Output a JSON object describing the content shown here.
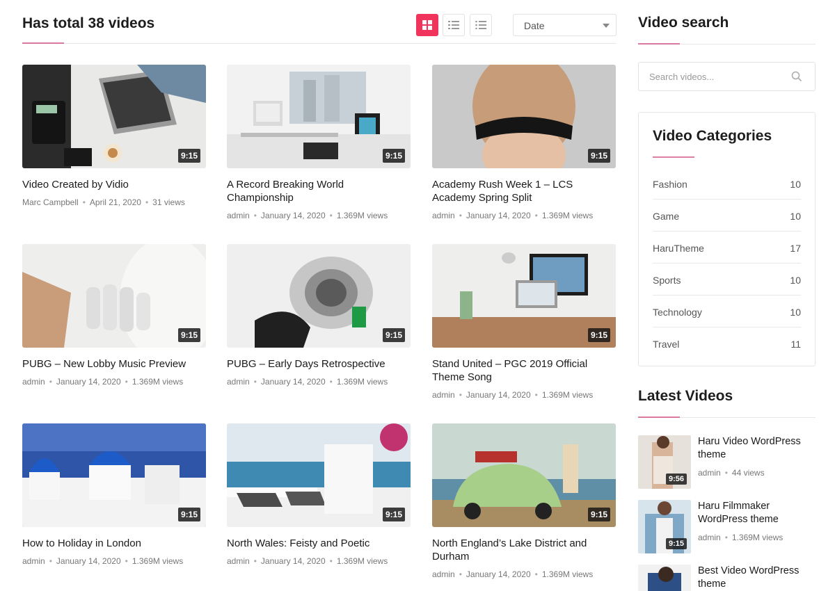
{
  "header": {
    "title": "Has total 38 videos",
    "sort_value": "Date",
    "accent_color": "#f0345b"
  },
  "view_icons": [
    "grid-view-icon",
    "list-view-icon",
    "list-view-alt-icon"
  ],
  "videos": [
    {
      "title": "Video Created by Vidio",
      "author": "Marc Campbell",
      "date": "April 21, 2020",
      "views": "31 views",
      "duration": "9:15"
    },
    {
      "title": "A Record Breaking World Championship",
      "author": "admin",
      "date": "January 14, 2020",
      "views": "1.369M views",
      "duration": "9:15"
    },
    {
      "title": "Academy Rush Week 1 – LCS Academy Spring Split",
      "author": "admin",
      "date": "January 14, 2020",
      "views": "1.369M views",
      "duration": "9:15"
    },
    {
      "title": "PUBG – New Lobby Music Preview",
      "author": "admin",
      "date": "January 14, 2020",
      "views": "1.369M views",
      "duration": "9:15"
    },
    {
      "title": "PUBG – Early Days Retrospective",
      "author": "admin",
      "date": "January 14, 2020",
      "views": "1.369M views",
      "duration": "9:15"
    },
    {
      "title": "Stand United – PGC 2019 Official Theme Song",
      "author": "admin",
      "date": "January 14, 2020",
      "views": "1.369M views",
      "duration": "9:15"
    },
    {
      "title": "How to Holiday in London",
      "author": "admin",
      "date": "January 14, 2020",
      "views": "1.369M views",
      "duration": "9:15"
    },
    {
      "title": "North Wales: Feisty and Poetic",
      "author": "admin",
      "date": "January 14, 2020",
      "views": "1.369M views",
      "duration": "9:15"
    },
    {
      "title": "North England’s Lake District and Durham",
      "author": "admin",
      "date": "January 14, 2020",
      "views": "1.369M views",
      "duration": "9:15"
    }
  ],
  "sidebar": {
    "search_title": "Video search",
    "search_placeholder": "Search videos...",
    "categories_title": "Video Categories",
    "categories": [
      {
        "name": "Fashion",
        "count": "10"
      },
      {
        "name": "Game",
        "count": "10"
      },
      {
        "name": "HaruTheme",
        "count": "17"
      },
      {
        "name": "Sports",
        "count": "10"
      },
      {
        "name": "Technology",
        "count": "10"
      },
      {
        "name": "Travel",
        "count": "11"
      }
    ],
    "latest_title": "Latest Videos",
    "latest": [
      {
        "title": "Haru Video WordPress theme",
        "author": "admin",
        "views": "44 views",
        "duration": "9:56"
      },
      {
        "title": "Haru Filmmaker WordPress theme",
        "author": "admin",
        "views": "1.369M views",
        "duration": "9:15"
      },
      {
        "title": "Best Video WordPress theme",
        "author": "",
        "views": "",
        "duration": ""
      }
    ]
  }
}
